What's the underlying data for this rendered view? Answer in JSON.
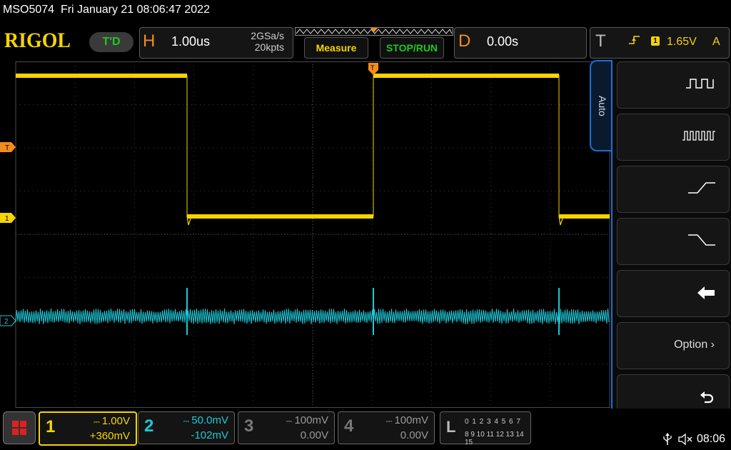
{
  "top": {
    "model": "MSO5074",
    "datetime": "Fri January 21 08:06:47 2022"
  },
  "brand": {
    "logo": "RIGOL",
    "td_badge": "T'D"
  },
  "horizontal": {
    "letter": "H",
    "timebase": "1.00us",
    "sample_rate": "2GSa/s",
    "memory_depth": "20kpts"
  },
  "buttons": {
    "measure": "Measure",
    "stop_run": "STOP/RUN"
  },
  "delay": {
    "letter": "D",
    "value": "0.00s"
  },
  "trigger": {
    "letter": "T",
    "source_channel": "1",
    "level": "1.65V",
    "sweep": "A",
    "edge_icon": "rising-edge-icon"
  },
  "markers": {
    "trigger_level": "T",
    "ch1_ground": "1",
    "ch2_ground": "2",
    "trigger_pos": "T"
  },
  "side_menu": {
    "tab": "Auto",
    "items": [
      {
        "icon": "single-period-icon"
      },
      {
        "icon": "multi-period-icon"
      },
      {
        "icon": "rise-time-icon"
      },
      {
        "icon": "fall-time-icon"
      },
      {
        "icon": "back-arrow-icon"
      },
      {
        "label": "Option"
      },
      {
        "icon": "undo-icon"
      }
    ]
  },
  "channels": [
    {
      "num": "1",
      "scale": "1.00V",
      "offset": "+360mV",
      "color": "#f5d400",
      "active": true
    },
    {
      "num": "2",
      "scale": "50.0mV",
      "offset": "-102mV",
      "color": "#1ec8d6",
      "active": true
    },
    {
      "num": "3",
      "scale": "100mV",
      "offset": "0.00V",
      "color": "#888888",
      "active": false
    },
    {
      "num": "4",
      "scale": "100mV",
      "offset": "0.00V",
      "color": "#888888",
      "active": false
    }
  ],
  "logic": {
    "letter": "L",
    "row1": "0 1 2 3  4 5 6 7",
    "row2": "8 9 10 11 12 13 14 15"
  },
  "status": {
    "clock": "08:06"
  },
  "colors": {
    "ch1": "#f5d400",
    "ch2": "#1ec8d6",
    "accent_orange": "#f58a1e",
    "menu_blue": "#1e6fd6"
  }
}
